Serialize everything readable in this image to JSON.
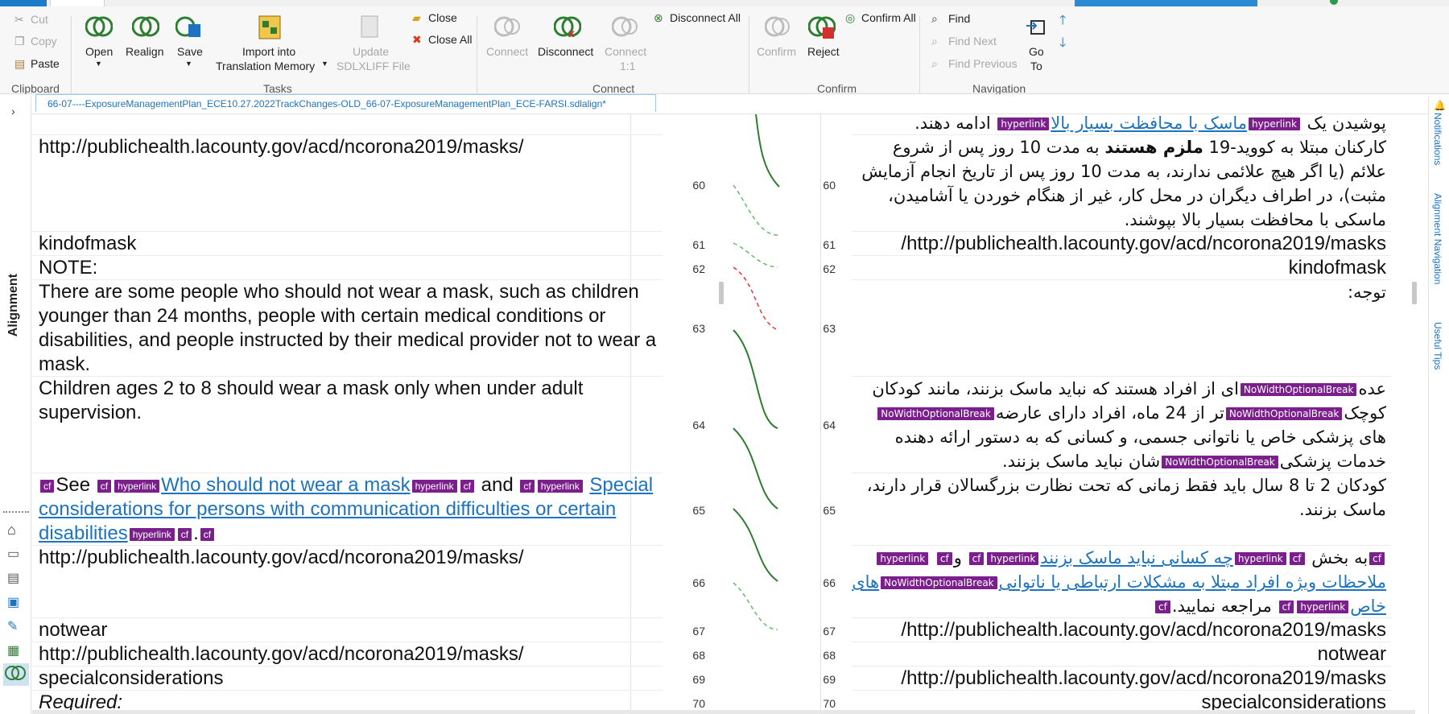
{
  "ribbon": {
    "clipboard": {
      "cut": "Cut",
      "copy": "Copy",
      "paste": "Paste",
      "group": "Clipboard"
    },
    "tasks": {
      "open": "Open",
      "realign": "Realign",
      "save": "Save",
      "import": "Import into",
      "import2": "Translation Memory",
      "update": "Update",
      "update2": "SDLXLIFF File",
      "close": "Close",
      "close_all": "Close All",
      "group": "Tasks"
    },
    "connect": {
      "connect": "Connect",
      "disconnect": "Disconnect",
      "connect11": "Connect",
      "connect11b": "1:1",
      "disconnect_all": "Disconnect All",
      "group": "Connect"
    },
    "confirm": {
      "confirm": "Confirm",
      "reject": "Reject",
      "confirm_all": "Confirm All",
      "group": "Confirm"
    },
    "navigation": {
      "find": "Find",
      "find_next": "Find Next",
      "find_previous": "Find Previous",
      "go_to": "Go",
      "go_to2": "To",
      "group": "Navigation"
    }
  },
  "document_tab": "66-07----ExposureManagementPlan_ECE10.27.2022TrackChanges-OLD_66-07-ExposureManagementPlan_ECE-FARSI.sdlalign*",
  "left_panel": {
    "title": "Alignment"
  },
  "right_panel": {
    "tabs": [
      "Notifications",
      "Alignment Navigation",
      "Useful Tips"
    ]
  },
  "source_rows": [
    {
      "num": "60",
      "text": "http://publichealth.lacounty.gov/acd/ncorona2019/masks/"
    },
    {
      "num": "61",
      "text": "kindofmask"
    },
    {
      "num": "62",
      "text": "NOTE:"
    },
    {
      "num": "63",
      "text": "There are some people who should not wear a mask, such as children younger than 24 months, people with certain medical conditions or disabilities, and people instructed by their medical provider not to wear a mask."
    },
    {
      "num": "64",
      "text": "Children ages 2 to 8 should wear a mask only when under adult supervision."
    },
    {
      "num": "65",
      "see": "See",
      "link1": "Who should not wear a mask",
      "and": "and",
      "link2": "Special considerations for persons with communication difficulties or certain disabilities",
      "dot": "."
    },
    {
      "num": "66",
      "text": "http://publichealth.lacounty.gov/acd/ncorona2019/masks/"
    },
    {
      "num": "67",
      "text": "notwear"
    },
    {
      "num": "68",
      "text": "http://publichealth.lacounty.gov/acd/ncorona2019/masks/"
    },
    {
      "num": "69",
      "text": "specialconsiderations"
    },
    {
      "num": "70",
      "text": "Required:"
    }
  ],
  "target_rows": [
    {
      "top_a": "پوشیدن یک",
      "top_link": "ماسک با محافظت بسیار بالا",
      "top_b": "ادامه دهند."
    },
    {
      "num": "60",
      "text_a": "کارکنان مبتلا به کووید-19",
      "bold": "ملزم هستند",
      "text_b": "به مدت 10 روز پس از شروع علائم (یا اگر هیچ علائمی ندارند، به مدت 10 روز پس از تاریخ انجام آزمایش مثبت)، در اطراف دیگران در محل کار، غیر از هنگام خوردن یا آشامیدن، ماسکی با محافظت بسیار بالا بپوشند."
    },
    {
      "num": "61",
      "text": "http://publichealth.lacounty.gov/acd/ncorona2019/masks/"
    },
    {
      "num": "62",
      "text": "kindofmask"
    },
    {
      "num": "63",
      "text": "توجه:"
    },
    {
      "num": "64",
      "a": "عده",
      "b": "ای از افراد هستند که نباید ماسک بزنند، مانند کودکان کوچک",
      "c": "تر از 24 ماه، افراد دارای عارضه",
      "d": "های پزشکی خاص یا ناتوانی جسمی، و کسانی که به دستور ارائه دهنده خدمات پزشکی",
      "e": "شان نباید ماسک بزنند."
    },
    {
      "num": "65",
      "text": "کودکان 2 تا 8 سال باید فقط زمانی که تحت نظارت بزرگسالان قرار دارند، ماسک بزنند."
    },
    {
      "num": "66",
      "a": "به بخش",
      "link1": "چه کسانی نباید ماسک بزنند",
      "and": "و",
      "link2": "ملاحظات ویژه افراد مبتلا به مشکلات ارتباطی یا ناتوانی",
      "link3": "های خاص",
      "end": "مراجعه نمایید."
    },
    {
      "num": "67",
      "text": "http://publichealth.lacounty.gov/acd/ncorona2019/masks/"
    },
    {
      "num": "68",
      "text": "notwear"
    },
    {
      "num": "69",
      "text": "http://publichealth.lacounty.gov/acd/ncorona2019/masks/"
    },
    {
      "num": "70",
      "text": "specialconsiderations"
    }
  ],
  "tags": {
    "hyperlink": "hyperlink",
    "cf": "cf",
    "nwob": "NoWidthOptionalBreak"
  },
  "colors": {
    "accent": "#1e73be",
    "tag": "#7b1f8c",
    "confirmed": "#2e7d32",
    "rejected": "#d32f2f"
  }
}
